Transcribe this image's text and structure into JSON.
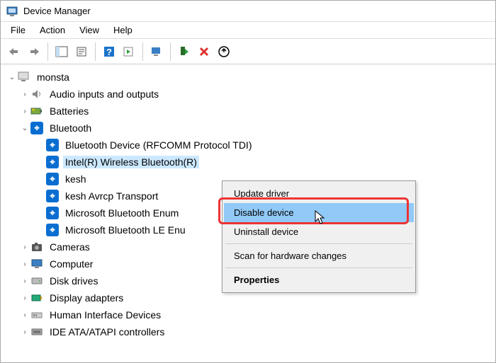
{
  "title": "Device Manager",
  "menu": {
    "file": "File",
    "action": "Action",
    "view": "View",
    "help": "Help"
  },
  "root": "monsta",
  "nodes": {
    "audio": "Audio inputs and outputs",
    "batteries": "Batteries",
    "bluetooth": "Bluetooth",
    "bt1": "Bluetooth Device (RFCOMM Protocol TDI)",
    "bt2": "Intel(R) Wireless Bluetooth(R)",
    "bt3": "kesh",
    "bt4": "kesh Avrcp Transport",
    "bt5": "Microsoft Bluetooth Enum",
    "bt6": "Microsoft Bluetooth LE Enu",
    "cameras": "Cameras",
    "computer": "Computer",
    "disk": "Disk drives",
    "display": "Display adapters",
    "hid": "Human Interface Devices",
    "ide": "IDE ATA/ATAPI controllers"
  },
  "context": {
    "update": "Update driver",
    "disable": "Disable device",
    "uninstall": "Uninstall device",
    "scan": "Scan for hardware changes",
    "properties": "Properties"
  }
}
